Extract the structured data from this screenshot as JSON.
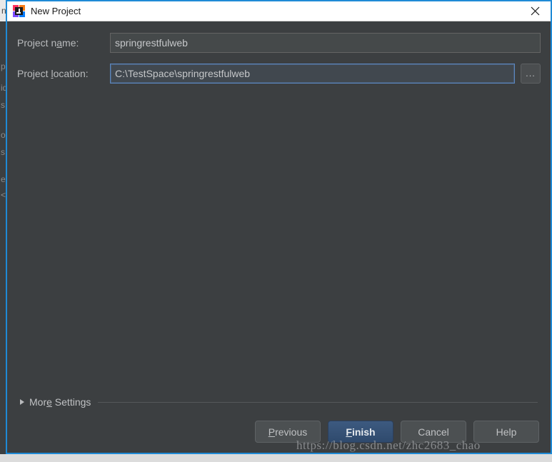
{
  "window": {
    "title": "New Project",
    "app_icon": "intellij-idea-icon",
    "close_icon": "close-icon",
    "accent_color": "#1f8ad6",
    "body_color": "#3c3f41"
  },
  "form": {
    "project_name": {
      "label_before": "Project n",
      "label_mnemonic": "a",
      "label_after": "me:",
      "value": "springrestfulweb",
      "placeholder": ""
    },
    "project_location": {
      "label_before": "Project ",
      "label_mnemonic": "l",
      "label_after": "ocation:",
      "value": "C:\\TestSpace\\springrestfulweb",
      "placeholder": "",
      "browse_label": "...",
      "browse_icon": "ellipsis-icon"
    }
  },
  "more_settings": {
    "label_before": "Mor",
    "label_mnemonic": "e",
    "label_after": " Settings",
    "expanded": false,
    "disclosure_icon": "triangle-right-icon"
  },
  "buttons": [
    {
      "name": "previous",
      "before": "",
      "mnemonic": "P",
      "after": "revious",
      "default": false
    },
    {
      "name": "finish",
      "before": "",
      "mnemonic": "F",
      "after": "inish",
      "default": true
    },
    {
      "name": "cancel",
      "before": "Cancel",
      "mnemonic": "",
      "after": "",
      "default": false
    },
    {
      "name": "help",
      "before": "Help",
      "mnemonic": "",
      "after": "",
      "default": false
    }
  ],
  "watermark": {
    "text": "https://blog.csdn.net/zhc2683_chao"
  },
  "background_window": {
    "title_fragment": "n",
    "text_fragments": [
      "p",
      "id",
      "s",
      "o",
      "s",
      "e",
      "<"
    ]
  }
}
